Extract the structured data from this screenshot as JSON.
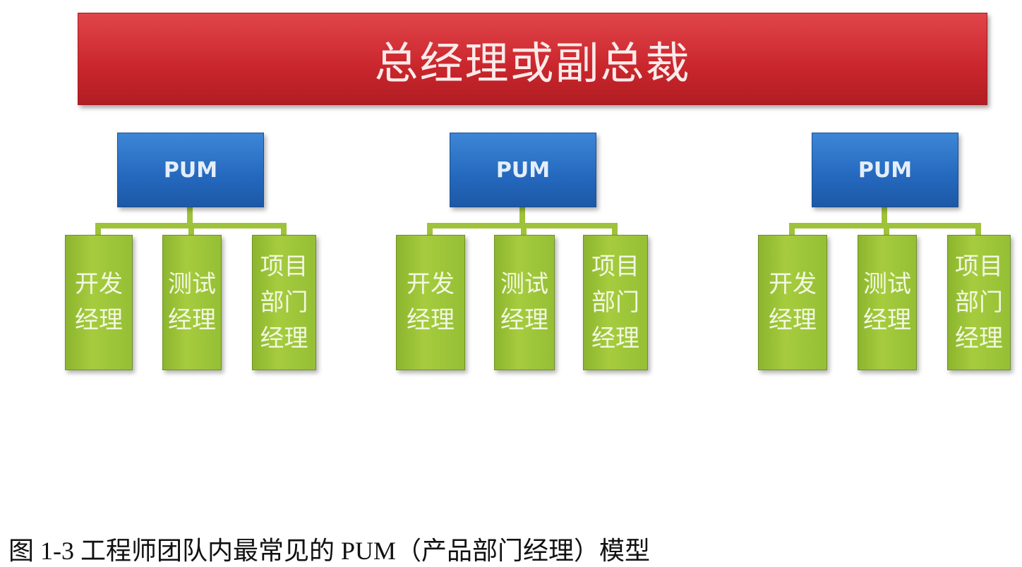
{
  "top": {
    "label": "总经理或副总裁"
  },
  "groups": [
    {
      "pum": "PUM",
      "leaves": [
        "开发经理",
        "测试经理",
        "项目部门经理"
      ]
    },
    {
      "pum": "PUM",
      "leaves": [
        "开发经理",
        "测试经理",
        "项目部门经理"
      ]
    },
    {
      "pum": "PUM",
      "leaves": [
        "开发经理",
        "测试经理",
        "项目部门经理"
      ]
    }
  ],
  "caption": "图 1-3  工程师团队内最常见的 PUM（产品部门经理）模型",
  "colors": {
    "top": "#c9262c",
    "pum": "#2468bd",
    "leaf": "#a6cc3e"
  }
}
